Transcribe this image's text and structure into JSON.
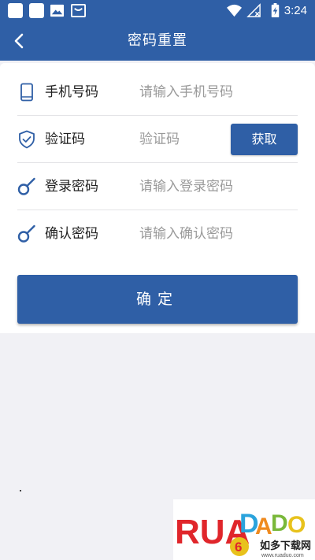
{
  "status_bar": {
    "time": "3:24",
    "icons": [
      "app-square-icon",
      "app-square-icon",
      "image-icon",
      "shopping-bag-icon",
      "wifi-icon",
      "no-signal-icon",
      "battery-charging-icon"
    ]
  },
  "header": {
    "title": "密码重置",
    "back_icon": "chevron-left-icon"
  },
  "form": {
    "phone": {
      "label": "手机号码",
      "placeholder": "请输入手机号码",
      "value": "",
      "icon": "phone-icon"
    },
    "code": {
      "label": "验证码",
      "placeholder": "验证码",
      "value": "",
      "icon": "shield-check-icon",
      "button_label": "获取"
    },
    "login_password": {
      "label": "登录密码",
      "placeholder": "请输入登录密码",
      "value": "",
      "icon": "key-icon"
    },
    "confirm_password": {
      "label": "确认密码",
      "placeholder": "请输入确认密码",
      "value": "",
      "icon": "key-icon"
    }
  },
  "confirm_button": {
    "label": "确定"
  },
  "watermark": {
    "logo_text": "RUADADO",
    "tagline": "如多下载网",
    "url": "www.ruaduo.com"
  },
  "colors": {
    "brand": "#2f5fa6",
    "background": "#f1f1f5",
    "panel": "#ffffff",
    "divider": "#e3e3e6",
    "placeholder": "#9a9a9a",
    "label": "#222222"
  }
}
